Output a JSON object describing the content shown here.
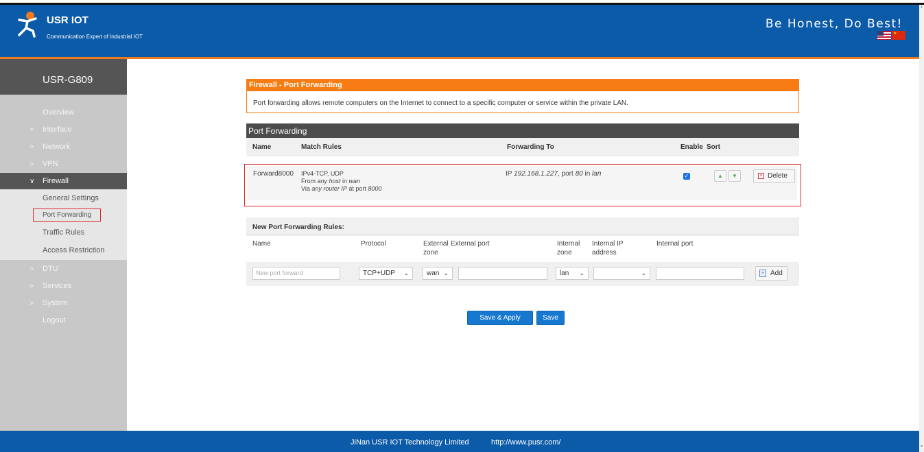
{
  "header": {
    "brand": "USR IOT",
    "brand_sub": "Communication Expert of Industrial IOT",
    "slogan": "Be Honest, Do Best!",
    "flags": [
      "us-flag-icon",
      "cn-flag-icon"
    ]
  },
  "sidebar": {
    "device": "USR-G809",
    "items": [
      {
        "label": "Overview",
        "chevron": false
      },
      {
        "label": "Interface",
        "chevron": true
      },
      {
        "label": "Network",
        "chevron": true
      },
      {
        "label": "VPN",
        "chevron": true
      },
      {
        "label": "Firewall",
        "chevron": true,
        "expanded": true
      }
    ],
    "sub_items": [
      {
        "label": "General Settings"
      },
      {
        "label": "Port Forwarding",
        "selected": true
      },
      {
        "label": "Traffic Rules"
      },
      {
        "label": "Access Restriction"
      }
    ],
    "items_after": [
      {
        "label": "DTU",
        "chevron": true
      },
      {
        "label": "Services",
        "chevron": true
      },
      {
        "label": "System",
        "chevron": true
      },
      {
        "label": "Logout",
        "chevron": false
      }
    ]
  },
  "page": {
    "title": "Firewall - Port Forwarding",
    "description": "Port forwarding allows remote computers on the Internet to connect to a specific computer or service within the private LAN."
  },
  "port_forwarding": {
    "section_title": "Port Forwarding",
    "columns": {
      "name": "Name",
      "match": "Match Rules",
      "forward": "Forwarding To",
      "enable": "Enable",
      "sort": "Sort"
    },
    "rules": [
      {
        "name": "Forward8000",
        "match_line1": "IPv4-TCP, UDP",
        "match_line2_a": "From ",
        "match_line2_b": "any host",
        "match_line2_c": " in ",
        "match_line2_d": "wan",
        "match_line3_a": "Via ",
        "match_line3_b": "any router IP",
        "match_line3_c": " at port ",
        "match_line3_d": "8000",
        "fwd_a": "IP ",
        "fwd_b": "192.168.1.227",
        "fwd_c": ", port ",
        "fwd_d": "80",
        "fwd_e": " in ",
        "fwd_f": "lan",
        "enabled": true,
        "delete_label": "Delete"
      }
    ]
  },
  "new_rules": {
    "title": "New Port Forwarding Rules:",
    "labels": {
      "name": "Name",
      "protocol": "Protocol",
      "ext_zone_1": "External",
      "ext_zone_2": "zone",
      "ext_port": "External port",
      "int_zone_1": "Internal",
      "int_zone_2": "zone",
      "int_ip_1": "Internal IP",
      "int_ip_2": "address",
      "int_port": "Internal port"
    },
    "name_placeholder": "New port forward",
    "protocol": "TCP+UDP",
    "ext_zone": "wan",
    "int_zone": "lan",
    "int_ip": "",
    "add_label": "Add"
  },
  "actions": {
    "save_apply": "Save & Apply",
    "save": "Save"
  },
  "footer": {
    "company": "JiNan USR IOT Technology Limited",
    "url": "http://www.pusr.com/"
  }
}
